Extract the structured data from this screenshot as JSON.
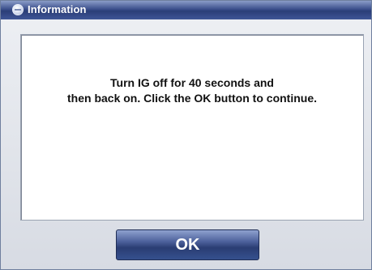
{
  "window": {
    "title": "Information",
    "title_icon": "info-circle-icon"
  },
  "dialog": {
    "message_line_1": "Turn IG off for 40 seconds and",
    "message_line_2": "then back on. Click the OK button to continue.",
    "ok_label": "OK"
  },
  "colors": {
    "titlebar": "#34488a",
    "button": "#34488a",
    "panel": "#ffffff"
  }
}
